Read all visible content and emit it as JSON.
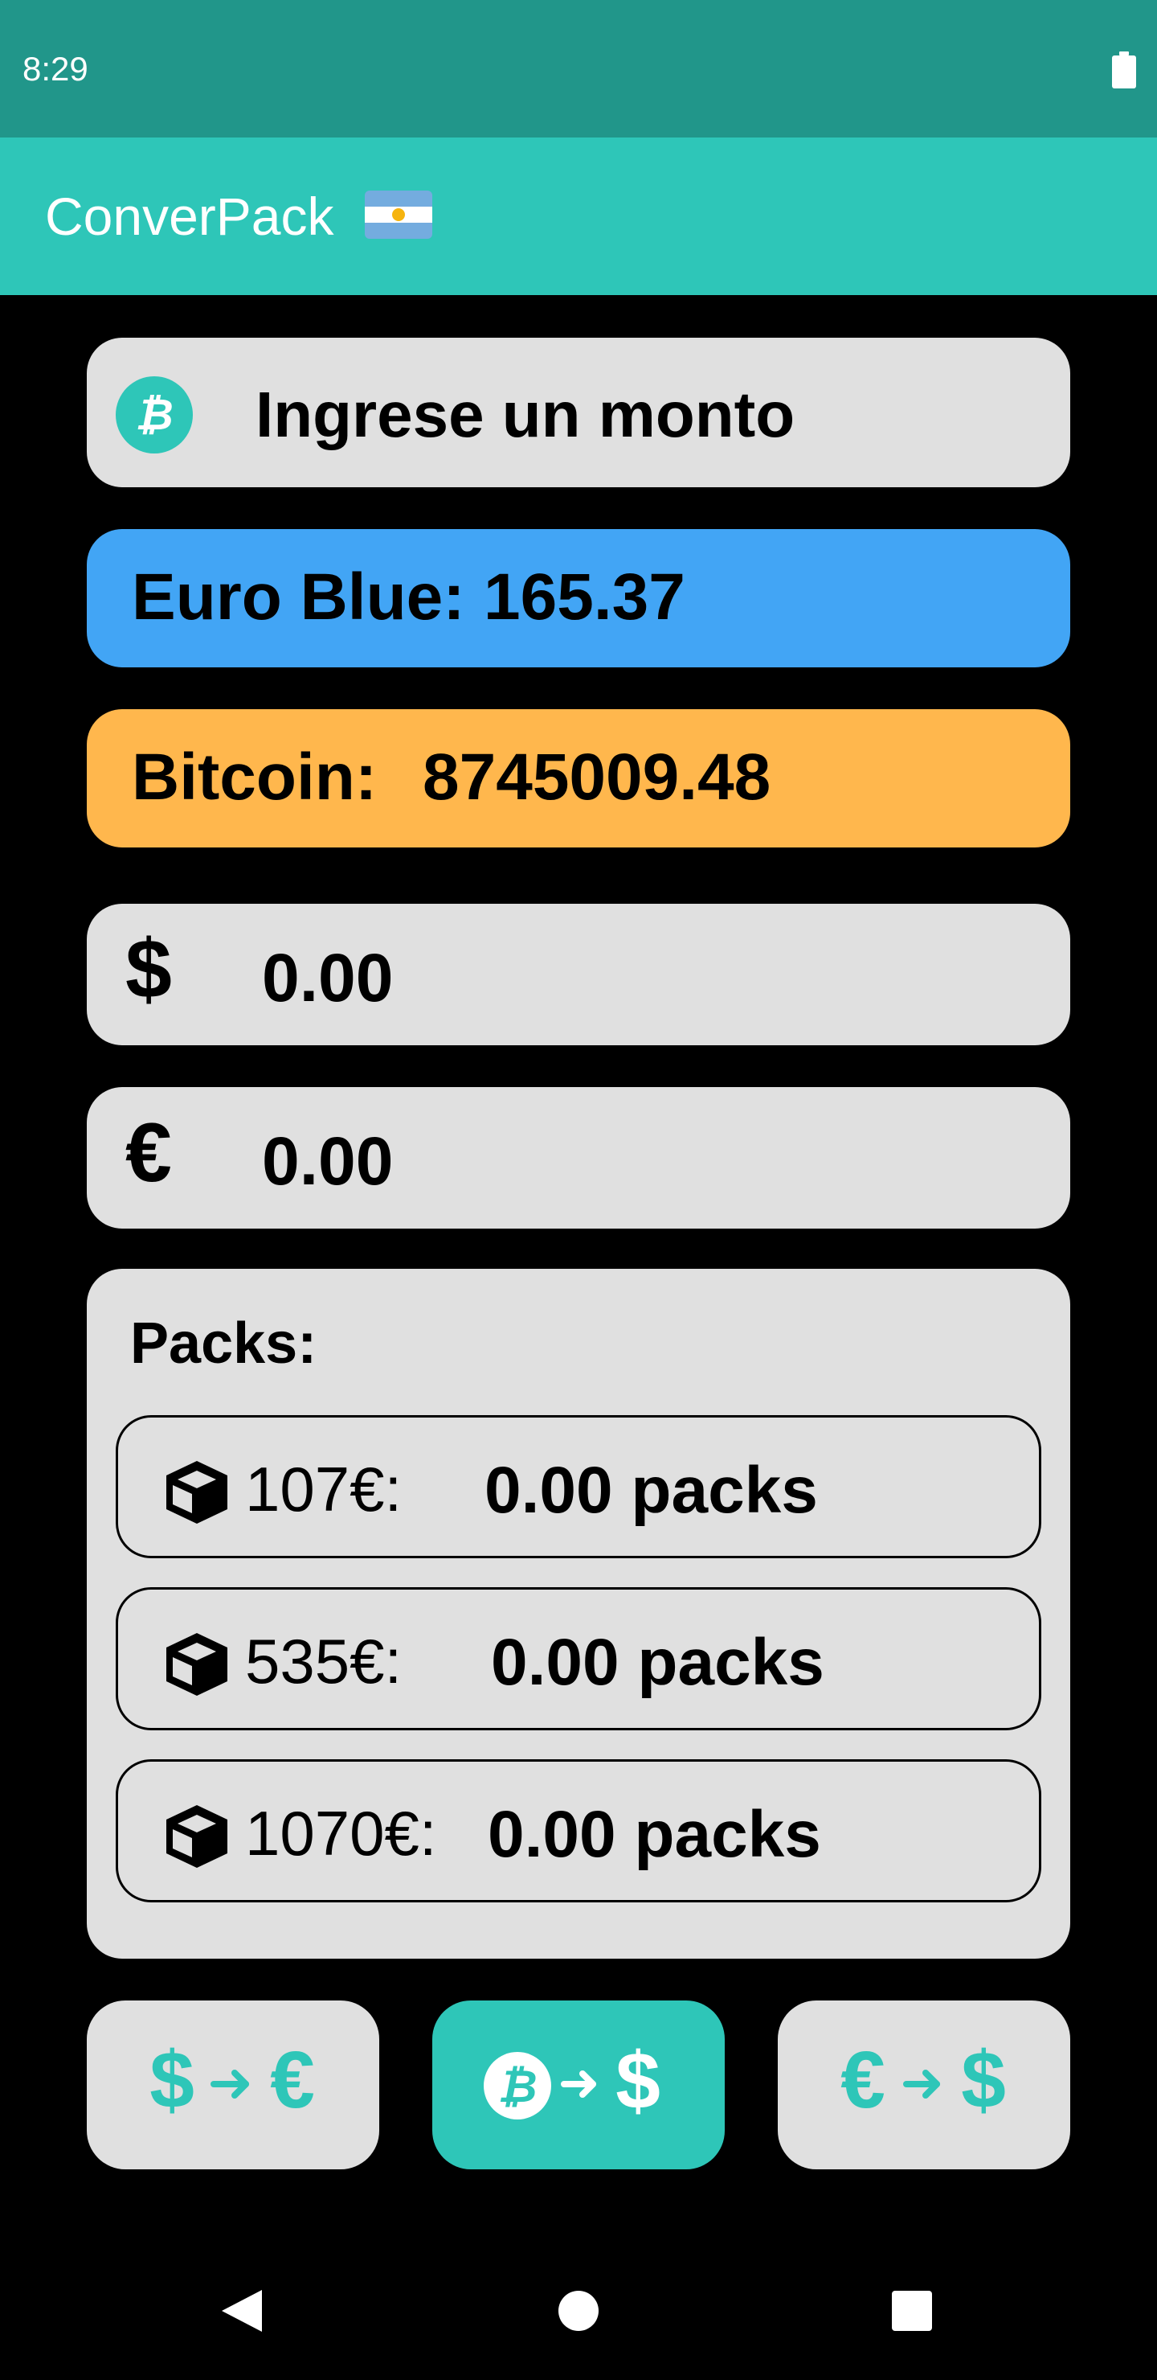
{
  "status_bar": {
    "time": "8:29"
  },
  "app_bar": {
    "title": "ConverPack"
  },
  "input": {
    "placeholder": "Ingrese un monto"
  },
  "rates": {
    "euro_label": "Euro Blue:",
    "euro_value": "165.37",
    "bitcoin_label": "Bitcoin:",
    "bitcoin_value": "8745009.48"
  },
  "results": {
    "usd_symbol": "$",
    "usd_value": "0.00",
    "eur_symbol": "€",
    "eur_value": "0.00"
  },
  "packs": {
    "title": "Packs:",
    "items": [
      {
        "price": "107€:",
        "quantity": "0.00 packs"
      },
      {
        "price": "535€:",
        "quantity": "0.00 packs"
      },
      {
        "price": "1070€:",
        "quantity": "0.00 packs"
      }
    ]
  },
  "buttons": {
    "usd_to_eur": {
      "from": "$",
      "to": "€"
    },
    "btc_to_usd": {
      "to": "$"
    },
    "eur_to_usd": {
      "from": "€",
      "to": "$"
    }
  },
  "colors": {
    "status_bar": "#21968a",
    "app_bar": "#2ec6b8",
    "accent": "#2ec6b8",
    "euro_card": "#42a5f5",
    "bitcoin_card": "#ffb74d",
    "card_bg": "#e0e0e0"
  },
  "icons": {
    "battery": "battery-icon",
    "bitcoin": "bitcoin-icon",
    "pack": "cube-icon",
    "arrow": "arrow-right-icon",
    "nav_back": "back-triangle-icon",
    "nav_home": "home-circle-icon",
    "nav_recents": "recents-square-icon"
  }
}
